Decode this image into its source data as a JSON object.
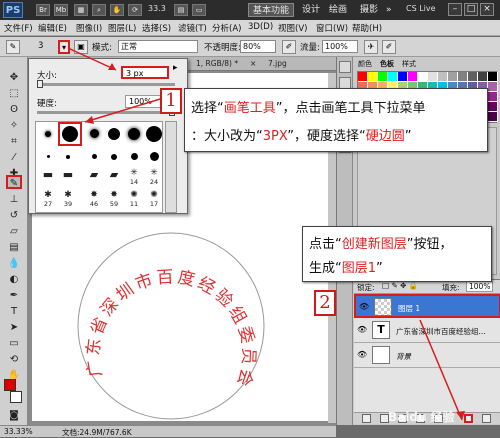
{
  "titlebar": {
    "logo": "PS",
    "zoom": "33.3",
    "workspaces": [
      "基本功能",
      "设计",
      "绘画",
      "摄影"
    ],
    "cs_live": "CS Live",
    "more": "»"
  },
  "menubar": {
    "items": [
      "文件(F)",
      "编辑(E)",
      "图像(I)",
      "图层(L)",
      "选择(S)",
      "滤镜(T)",
      "分析(A)",
      "3D(D)",
      "视图(V)",
      "窗口(W)",
      "帮助(H)"
    ]
  },
  "optbar": {
    "brush_size": "3",
    "mode_label": "模式:",
    "mode_value": "正常",
    "opacity_label": "不透明度:",
    "opacity_value": "80%",
    "flow_label": "流量:",
    "flow_value": "100%"
  },
  "brush_picker": {
    "size_label": "大小:",
    "size_value": "3 px",
    "hardness_label": "硬度:",
    "hardness_value": "100%",
    "row3_labels": [
      "",
      "",
      "",
      "",
      "14",
      "24"
    ],
    "row4_labels": [
      "27",
      "39",
      "46",
      "59",
      "11",
      "17"
    ]
  },
  "document": {
    "tab_text": "1, RGB/8) *",
    "tab2_text": "7.jpg",
    "stamp_text": "广东省深圳市百度经验组委员会"
  },
  "panels": {
    "tab_color": "颜色",
    "tab_swatches": "色板",
    "tab_styles": "样式",
    "lock_label": "锁定:",
    "fill_label": "填充:",
    "fill_value": "100%"
  },
  "layers": [
    {
      "name": "图层 1",
      "selected": true,
      "thumb": ""
    },
    {
      "name": "广东省深圳市百度经验组...",
      "selected": false,
      "thumb": "T"
    },
    {
      "name": "背景",
      "selected": false,
      "thumb": ""
    }
  ],
  "status": {
    "zoom": "33.33%",
    "doc_label": "文档:24.9M/767.6K"
  },
  "annotations": {
    "step1_num": "1",
    "step1_line1_a": "选择“",
    "step1_line1_b": "画笔工具",
    "step1_line1_c": "”，点击画笔工具下拉菜单",
    "step1_line2_a": "：大小改为“",
    "step1_line2_b": "3PX",
    "step1_line2_c": "”，硬度选择“",
    "step1_line2_d": "硬边圆",
    "step1_line2_e": "”",
    "step2_num": "2",
    "step2_line1_a": "点击“",
    "step2_line1_b": "创建新图层",
    "step2_line1_c": "”按钮，",
    "step2_line2_a": "生成“",
    "step2_line2_b": "图层1",
    "step2_line2_c": "”"
  },
  "watermark": "Baidu 经验",
  "colors": {
    "accent_red": "#d61c1c",
    "stamp_red": "#e03030",
    "layer_selected": "#3b76d2",
    "foreground": "#e00000",
    "background": "#ffffff"
  }
}
